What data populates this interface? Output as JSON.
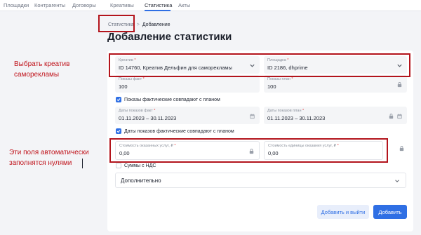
{
  "nav": {
    "items": [
      "Площадки",
      "Контрагенты",
      "Договоры",
      "Креативы",
      "Статистика",
      "Акты"
    ],
    "active": "Статистика"
  },
  "breadcrumb": {
    "parent": "Статистика",
    "separator": ">",
    "current": "Добавление"
  },
  "page_title": "Добавление статистики",
  "form": {
    "creative": {
      "label": "Креатив",
      "required_mark": "*",
      "value": "ID 14760, Креатив Дельфин для саморекламы"
    },
    "platform": {
      "label": "Площадка",
      "required_mark": "*",
      "value": "ID 2186, dhprime"
    },
    "impressions_fact": {
      "label": "Показы факт",
      "required_mark": "*",
      "value": "100"
    },
    "impressions_plan": {
      "label": "Показы план",
      "required_mark": "*",
      "value": "100"
    },
    "impressions_match": {
      "label": "Показы фактические совпадают с планом",
      "checked": true
    },
    "dates_fact": {
      "label": "Даты показов факт",
      "required_mark": "*",
      "value": "01.11.2023 – 30.11.2023"
    },
    "dates_plan": {
      "label": "Даты показов план",
      "required_mark": "*",
      "value": "01.11.2023 – 30.11.2023"
    },
    "dates_match": {
      "label": "Даты показов фактические совпадают с планом",
      "checked": true
    },
    "services_cost": {
      "label": "Стоимость оказанных услуг, ₽",
      "required_mark": "*",
      "value": "0,00"
    },
    "unit_cost": {
      "label": "Стоимость единицы оказания услуг, ₽",
      "required_mark": "*",
      "value": "0,00"
    },
    "vat": {
      "label": "Суммы с НДС",
      "checked": false
    },
    "extra": {
      "label": "Дополнительно"
    }
  },
  "buttons": {
    "add_and_exit": "Добавить и выйти",
    "add": "Добавить"
  },
  "annotations": {
    "creative_note": "Выбрать креатив саморекламы",
    "zeros_note": "Эти поля автоматически заполнятся нулями"
  },
  "colors": {
    "accent": "#2f6fe4",
    "annotation": "#b3141c"
  },
  "icons": [
    "chevron-down-icon",
    "lock-icon",
    "calendar-icon",
    "checkbox-check-icon"
  ]
}
